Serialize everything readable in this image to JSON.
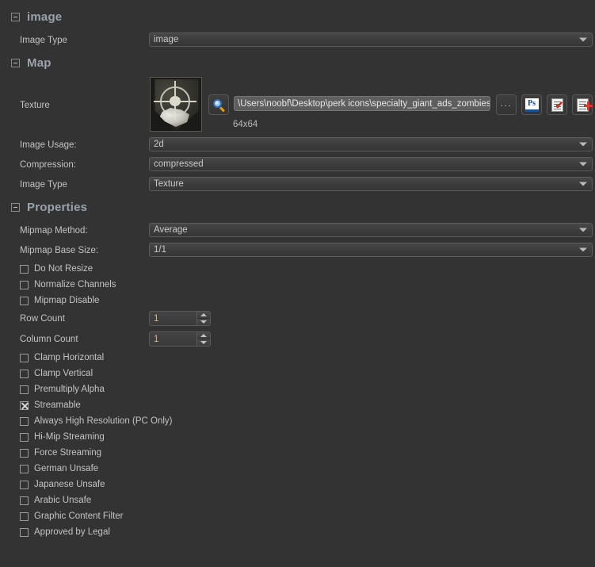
{
  "panel": {
    "background_color": "#333333",
    "accent_color": "#9aa3ab"
  },
  "sections": [
    {
      "id": "image",
      "title": "image",
      "collapse_icon": "minus-box-icon"
    },
    {
      "id": "map",
      "title": "Map",
      "collapse_icon": "minus-box-icon"
    },
    {
      "id": "properties",
      "title": "Properties",
      "collapse_icon": "minus-box-icon"
    }
  ],
  "image_section": {
    "image_type": {
      "label": "Image Type",
      "value": "image"
    }
  },
  "map_section": {
    "texture": {
      "label": "Texture",
      "preview_icon": "texture-thumbnail",
      "browse_icon": "magnifier-icon",
      "path": "\\Users\\noobf\\Desktop\\perk icons\\specialty_giant_ads_zombies.tif",
      "dimensions": "64x64",
      "buttons": [
        {
          "name": "ellipsis-button",
          "label": "...",
          "icon": "ellipsis-icon"
        },
        {
          "name": "photoshop-button",
          "label": "Ps",
          "icon": "photoshop-icon"
        },
        {
          "name": "edit-document-button",
          "label": "",
          "icon": "document-check-icon"
        },
        {
          "name": "add-document-button",
          "label": "",
          "icon": "document-plus-icon"
        }
      ]
    },
    "image_usage": {
      "label": "Image Usage:",
      "value": "2d"
    },
    "compression": {
      "label": "Compression:",
      "value": "compressed"
    },
    "image_type": {
      "label": "Image Type",
      "value": "Texture"
    }
  },
  "properties_section": {
    "mipmap_method": {
      "label": "Mipmap Method:",
      "value": "Average"
    },
    "mipmap_base_size": {
      "label": "Mipmap Base Size:",
      "value": "1/1"
    },
    "checkboxes_top": [
      {
        "label": "Do Not Resize",
        "checked": false
      },
      {
        "label": "Normalize Channels",
        "checked": false
      },
      {
        "label": "Mipmap Disable",
        "checked": false
      }
    ],
    "row_count": {
      "label": "Row Count",
      "value": "1"
    },
    "column_count": {
      "label": "Column Count",
      "value": "1"
    },
    "checkboxes_bottom": [
      {
        "label": "Clamp Horizontal",
        "checked": false
      },
      {
        "label": "Clamp Vertical",
        "checked": false
      },
      {
        "label": "Premultiply Alpha",
        "checked": false
      },
      {
        "label": "Streamable",
        "checked": true
      },
      {
        "label": "Always High Resolution (PC Only)",
        "checked": false
      },
      {
        "label": "Hi-Mip Streaming",
        "checked": false
      },
      {
        "label": "Force Streaming",
        "checked": false
      },
      {
        "label": "German Unsafe",
        "checked": false
      },
      {
        "label": "Japanese Unsafe",
        "checked": false
      },
      {
        "label": "Arabic Unsafe",
        "checked": false
      },
      {
        "label": "Graphic Content Filter",
        "checked": false
      },
      {
        "label": "Approved by Legal",
        "checked": false
      }
    ]
  }
}
